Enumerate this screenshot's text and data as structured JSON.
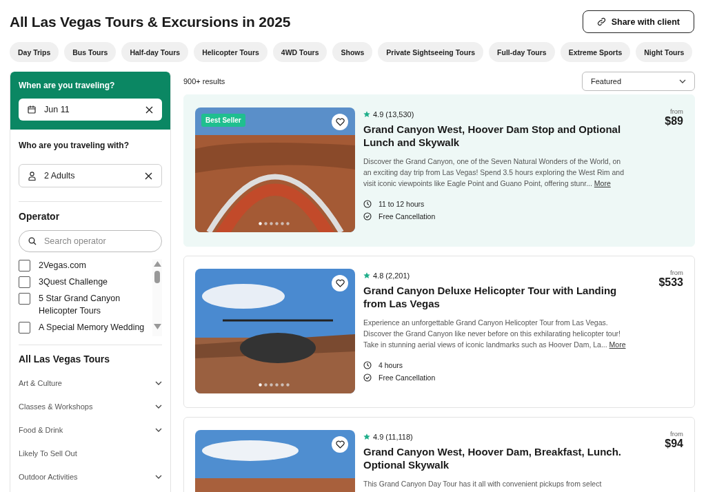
{
  "page_title": "All Las Vegas Tours & Excursions in 2025",
  "share_button": "Share with client",
  "category_chips": [
    "Day Trips",
    "Bus Tours",
    "Half-day Tours",
    "Helicopter Tours",
    "4WD Tours",
    "Shows",
    "Private Sightseeing Tours",
    "Full-day Tours",
    "Extreme Sports",
    "Night Tours"
  ],
  "sidebar": {
    "when_label": "When are you traveling?",
    "date_value": "Jun 11",
    "who_label": "Who are you traveling with?",
    "travelers_value": "2 Adults",
    "operator_heading": "Operator",
    "operator_search_placeholder": "Search operator",
    "operators": [
      {
        "label": "2Vegas.com",
        "checked": false
      },
      {
        "label": "3Quest Challenge",
        "checked": false
      },
      {
        "label": "5 Star Grand Canyon Helicopter Tours",
        "checked": false
      },
      {
        "label": "A Special Memory Wedding",
        "checked": false
      }
    ],
    "tours_heading": "All Las Vegas Tours",
    "tour_categories": [
      {
        "label": "Art & Culture",
        "kind": "group"
      },
      {
        "label": "Classes & Workshops",
        "kind": "group"
      },
      {
        "label": "Food & Drink",
        "kind": "group"
      },
      {
        "label": "Likely To Sell Out",
        "kind": "link"
      },
      {
        "label": "Outdoor Activities",
        "kind": "group"
      }
    ]
  },
  "results_count": "900+ results",
  "sort": {
    "value": "Featured"
  },
  "tours": [
    {
      "highlighted": true,
      "badge": "Best Seller",
      "rating": "4.9 (13,530)",
      "title": "Grand Canyon West, Hoover Dam Stop and Optional Lunch and Skywalk",
      "description": "Discover the Grand Canyon, one of the Seven Natural Wonders of the World, on an exciting day trip from Las Vegas! Spend 3.5 hours exploring the West Rim and visit iconic viewpoints like Eagle Point and Guano Point, offering stunr...",
      "more": "More",
      "duration": "11 to 12 hours",
      "cancellation": "Free Cancellation",
      "price_label": "from",
      "price": "$89"
    },
    {
      "highlighted": false,
      "rating": "4.8 (2,201)",
      "title": "Grand Canyon Deluxe Helicopter Tour with Landing from Las Vegas",
      "description": "Experience an unforgettable Grand Canyon Helicopter Tour from Las Vegas. Discover the Grand Canyon like never before on this exhilarating helicopter tour! Take in stunning aerial views of iconic landmarks such as Hoover Dam, La...",
      "more": "More",
      "duration": "4 hours",
      "cancellation": "Free Cancellation",
      "price_label": "from",
      "price": "$533"
    },
    {
      "highlighted": false,
      "rating": "4.9 (11,118)",
      "title": "Grand Canyon West, Hoover Dam, Breakfast, Lunch. Optional Skywalk",
      "description": "This Grand Canyon Day Tour has it all with convenient pickups from select",
      "price_label": "from",
      "price": "$94"
    }
  ]
}
